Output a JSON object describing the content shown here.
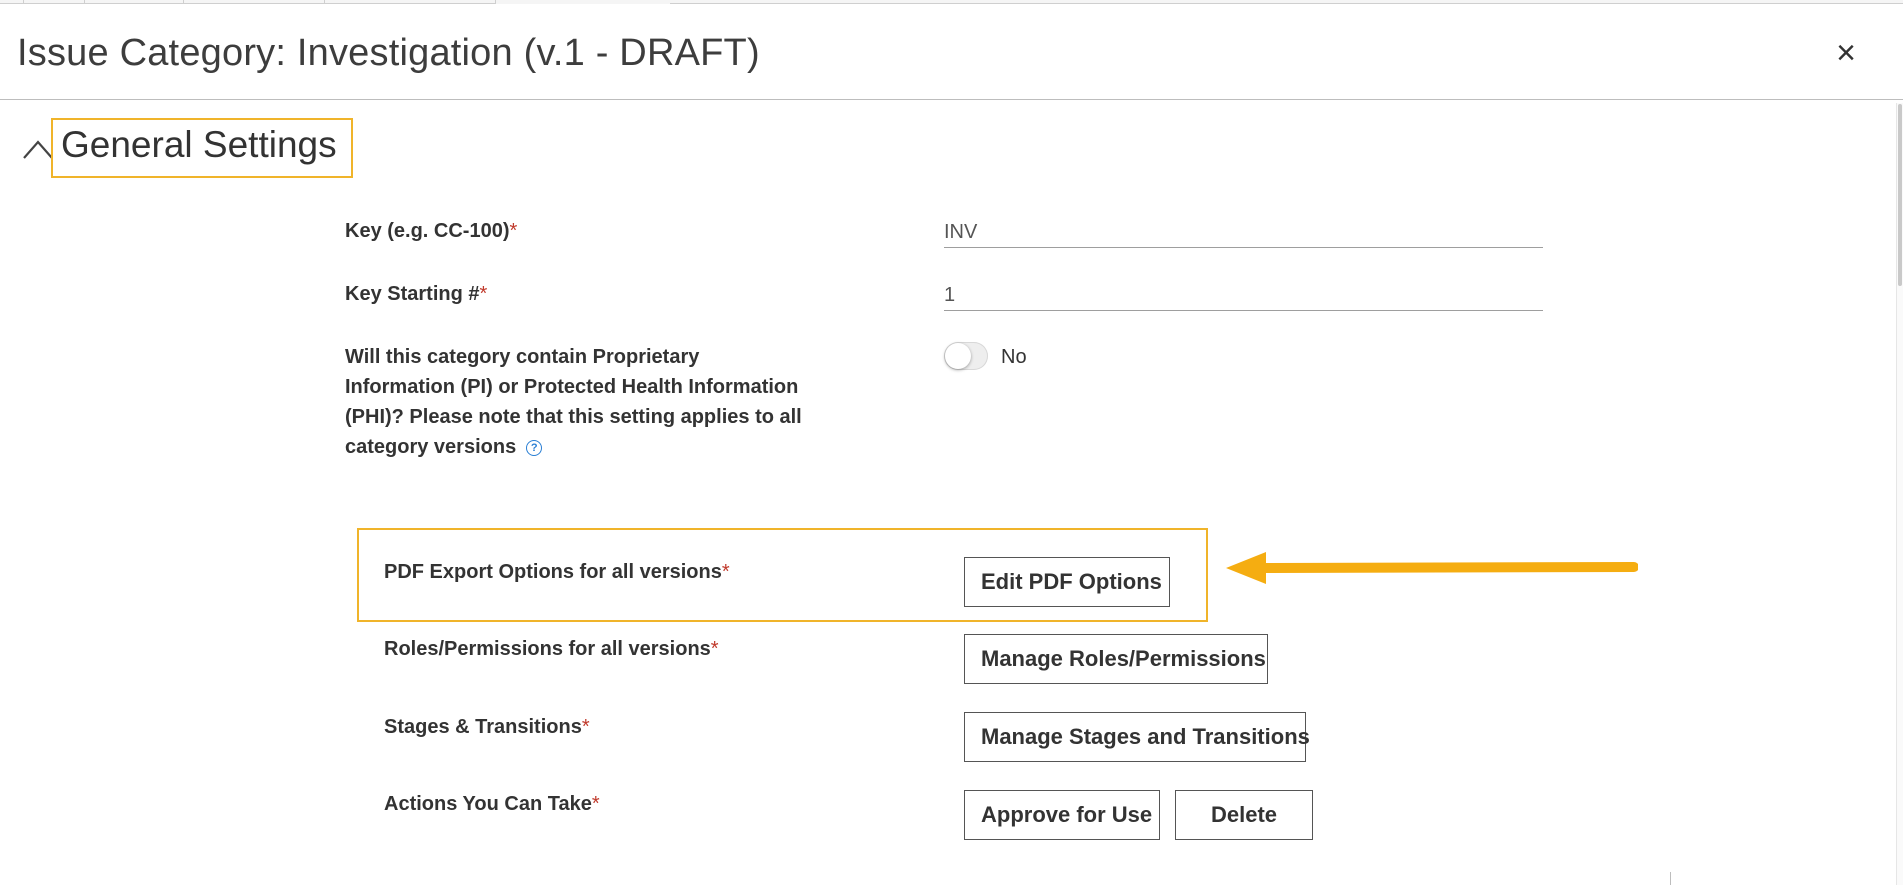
{
  "dialog": {
    "title": "Issue Category: Investigation (v.1 - DRAFT)",
    "close_symbol": "×",
    "close_icon": "close-icon"
  },
  "section": {
    "title": "General Settings",
    "collapse_icon": "chevron-up-icon"
  },
  "fields": {
    "key": {
      "label": "Key (e.g. CC-100)",
      "required_mark": "*",
      "value": "INV"
    },
    "key_start": {
      "label": "Key Starting #",
      "required_mark": "*",
      "value": "1"
    },
    "pi": {
      "label": "Will this category contain Proprietary Information (PI) or Protected Health Information (PHI)? Please note that this setting applies to all category versions",
      "help_icon": "help-icon",
      "help_symbol": "?",
      "toggle_on": false,
      "toggle_text": "No"
    }
  },
  "rows": {
    "pdf": {
      "label": "PDF Export Options for all versions",
      "required_mark": "*",
      "button": "Edit PDF Options"
    },
    "roles": {
      "label": "Roles/Permissions for all versions",
      "required_mark": "*",
      "button": "Manage Roles/Permissions"
    },
    "stages": {
      "label": "Stages & Transitions",
      "required_mark": "*",
      "button": "Manage Stages and Transitions"
    },
    "actions": {
      "label": "Actions You Can Take",
      "required_mark": "*",
      "approve_button": "Approve for Use",
      "delete_button": "Delete"
    }
  },
  "annotation": {
    "highlight_color": "#f0b42a",
    "arrow_color": "#f5ad11"
  },
  "colors": {
    "required": "#c0392b",
    "help": "#2a7fd4"
  }
}
